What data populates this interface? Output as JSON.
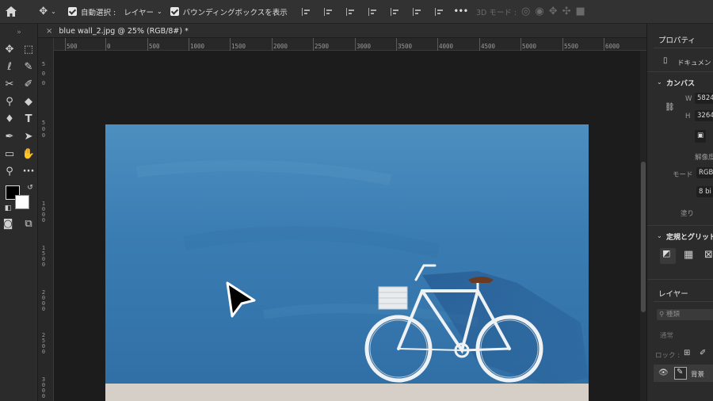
{
  "options_bar": {
    "auto_select_label": "自動選択 :",
    "auto_select_value": "レイヤー",
    "bounding_box_label": "バウンディングボックスを表示",
    "more_label": "•••",
    "mode_3d_label": "3D モード :"
  },
  "document_tab": {
    "close_label": "×",
    "title": "blue wall_2.jpg @ 25% (RGB/8#) *"
  },
  "ruler_h": [
    "500",
    "0",
    "500",
    "1000",
    "1500",
    "2000",
    "2500",
    "3000",
    "3500",
    "4000",
    "4500",
    "5000",
    "5500",
    "6000"
  ],
  "ruler_v": [
    "5",
    "0",
    "0",
    "5",
    "0",
    "0",
    "1 0 0 0",
    "1 5 0 0",
    "2 0 0 0",
    "2 5 0 0",
    "3 0 0 0"
  ],
  "properties": {
    "tab_label": "プロパティ",
    "document_label": "ドキュメント",
    "canvas_section": "カンバス",
    "w_label": "W",
    "w_value": "5824",
    "h_label": "H",
    "h_value": "3264",
    "resolution_label": "解像度",
    "mode_label": "モード",
    "mode_value": "RGB",
    "bits_value": "8 bi",
    "fill_label": "塗り",
    "guides_section": "定規とグリッド"
  },
  "layers": {
    "tab_label": "レイヤー",
    "search_placeholder": "種類",
    "blend_label": "通常",
    "lock_label": "ロック :",
    "layer_name": "背景"
  },
  "colors": {
    "foreground": "#000000",
    "background": "#ffffff",
    "wall_blue": "#3a7db3"
  }
}
